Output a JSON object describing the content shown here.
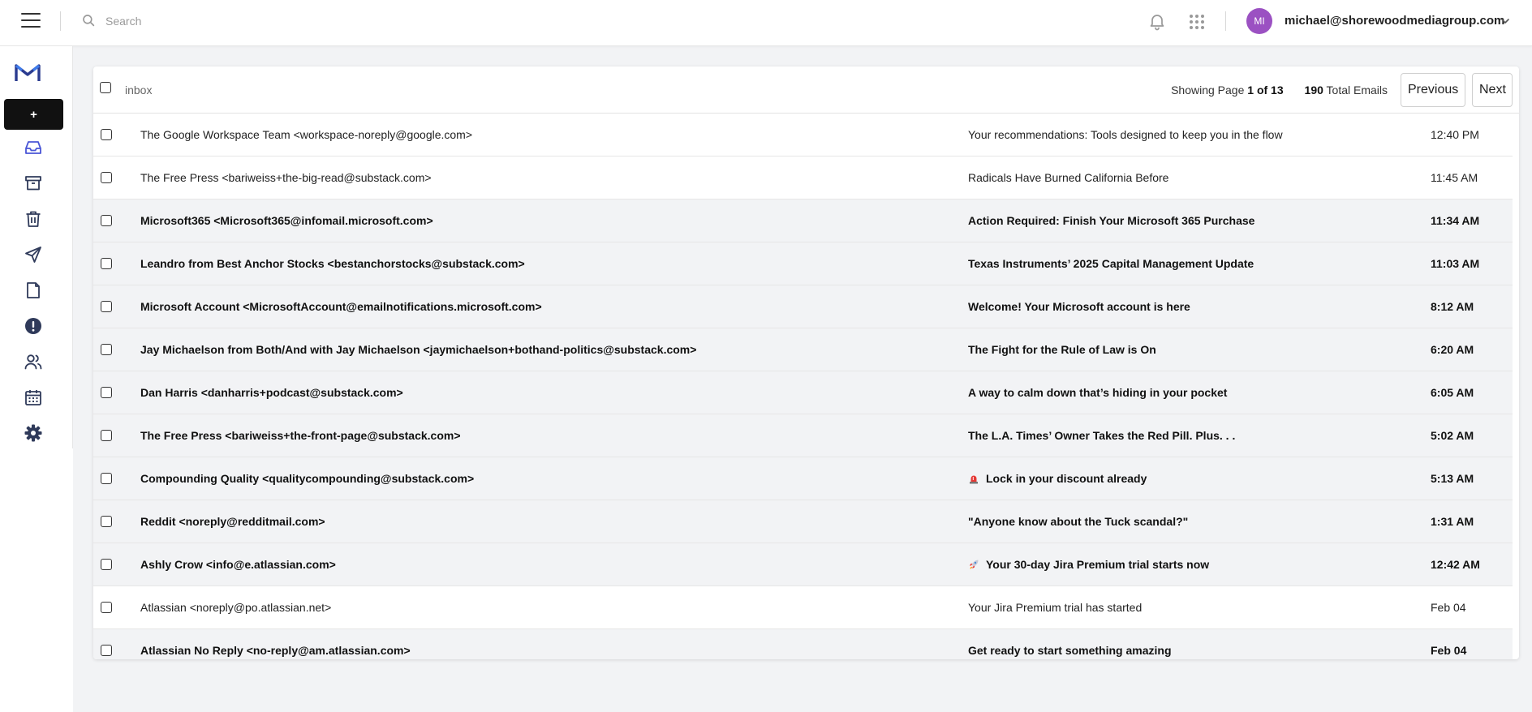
{
  "header": {
    "search_placeholder": "Search",
    "avatar_initials": "MI",
    "account_email": "michael@shorewoodmediagroup.com"
  },
  "sidebar": {
    "compose_label": "+",
    "items": [
      {
        "name": "inbox",
        "icon": "inbox-icon",
        "active": true
      },
      {
        "name": "archive",
        "icon": "archive-icon"
      },
      {
        "name": "trash",
        "icon": "trash-icon"
      },
      {
        "name": "sent",
        "icon": "send-icon"
      },
      {
        "name": "drafts",
        "icon": "file-icon"
      },
      {
        "name": "spam",
        "icon": "alert-icon"
      },
      {
        "name": "contacts",
        "icon": "users-icon"
      },
      {
        "name": "calendar",
        "icon": "calendar-icon"
      },
      {
        "name": "settings",
        "icon": "gear-icon"
      }
    ]
  },
  "mailbox": {
    "folder": "inbox",
    "pagination": {
      "prefix": "Showing Page",
      "page_text": "1 of 13",
      "total_count": "190",
      "total_label": "Total Emails"
    },
    "prev_label": "Previous",
    "next_label": "Next",
    "emails": [
      {
        "from": "The Google Workspace Team <workspace-noreply@google.com>",
        "subject": "Your recommendations: Tools designed to keep you in the flow",
        "time": "12:40 PM",
        "unread": false
      },
      {
        "from": "The Free Press <bariweiss+the-big-read@substack.com>",
        "subject": "Radicals Have Burned California Before",
        "time": "11:45 AM",
        "unread": false
      },
      {
        "from": "Microsoft365 <Microsoft365@infomail.microsoft.com>",
        "subject": "Action Required: Finish Your Microsoft 365 Purchase",
        "time": "11:34 AM",
        "unread": true
      },
      {
        "from": "Leandro from Best Anchor Stocks <bestanchorstocks@substack.com>",
        "subject": "Texas Instruments’ 2025 Capital Management Update",
        "time": "11:03 AM",
        "unread": true
      },
      {
        "from": "Microsoft Account <MicrosoftAccount@emailnotifications.microsoft.com>",
        "subject": "Welcome! Your Microsoft account is here",
        "time": "8:12 AM",
        "unread": true
      },
      {
        "from": "Jay Michaelson from Both/And with Jay Michaelson <jaymichaelson+bothand-politics@substack.com>",
        "subject": "The Fight for the Rule of Law is On",
        "time": "6:20 AM",
        "unread": true
      },
      {
        "from": "Dan Harris <danharris+podcast@substack.com>",
        "subject": "A way to calm down that’s hiding in your pocket",
        "time": "6:05 AM",
        "unread": true
      },
      {
        "from": "The Free Press <bariweiss+the-front-page@substack.com>",
        "subject": "The L.A. Times’ Owner Takes the Red Pill. Plus. . .",
        "time": "5:02 AM",
        "unread": true
      },
      {
        "from": "Compounding Quality <qualitycompounding@substack.com>",
        "subject": "Lock in your discount already",
        "subject_icon": "siren-emoji-icon",
        "time": "5:13 AM",
        "unread": true
      },
      {
        "from": "Reddit <noreply@redditmail.com>",
        "subject": "\"Anyone know about the Tuck scandal?\"",
        "time": "1:31 AM",
        "unread": true
      },
      {
        "from": "Ashly Crow <info@e.atlassian.com>",
        "subject": "Your 30-day Jira Premium trial starts now",
        "subject_icon": "rocket-emoji-icon",
        "time": "12:42 AM",
        "unread": true
      },
      {
        "from": "Atlassian <noreply@po.atlassian.net>",
        "subject": "Your Jira Premium trial has started",
        "time": "Feb 04",
        "unread": false
      },
      {
        "from": "Atlassian No Reply <no-reply@am.atlassian.com>",
        "subject": "Get ready to start something amazing",
        "time": "Feb 04",
        "unread": true
      }
    ]
  }
}
